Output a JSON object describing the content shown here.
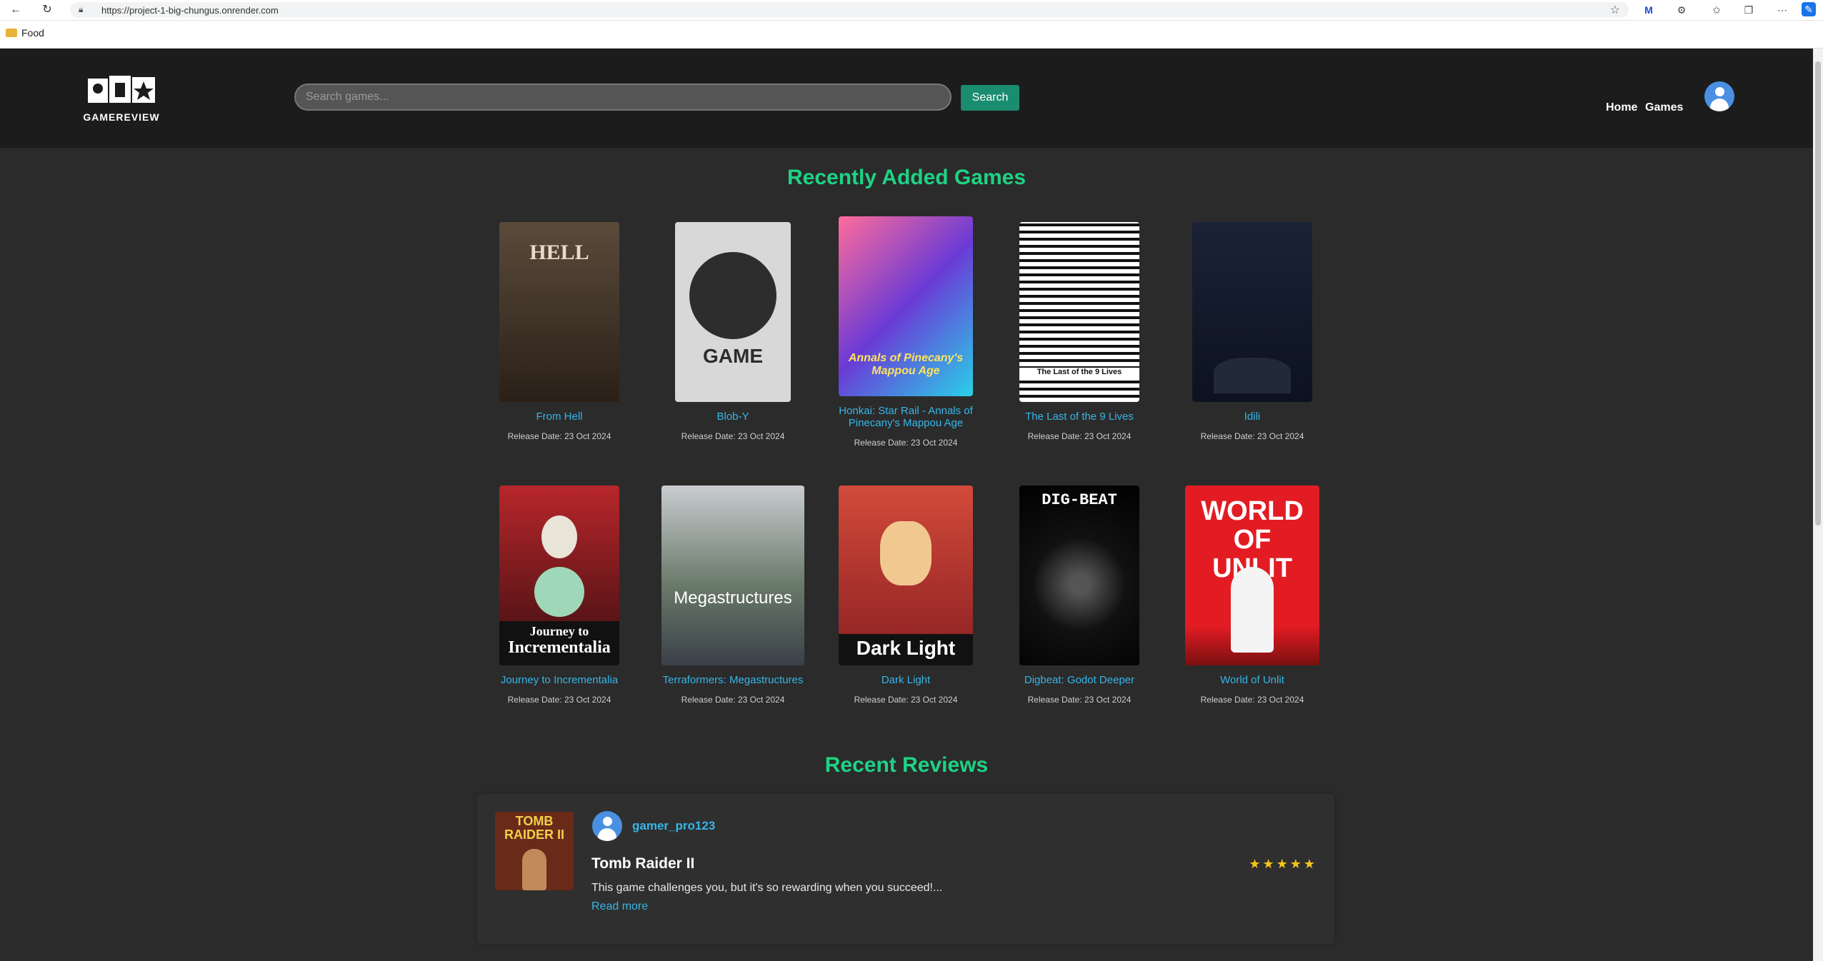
{
  "browser": {
    "url": "https://project-1-big-chungus.onrender.com",
    "bookmark_folder": "Food"
  },
  "header": {
    "logo_text": "GAMEREVIEW",
    "search_placeholder": "Search games...",
    "search_button": "Search",
    "nav": [
      {
        "label": "Home"
      },
      {
        "label": "Games"
      }
    ]
  },
  "recent_games": {
    "title": "Recently Added Games",
    "games": [
      {
        "title": "From Hell",
        "date": "Release Date: 23 Oct 2024"
      },
      {
        "title": "Blob-Y",
        "date": "Release Date: 23 Oct 2024"
      },
      {
        "title": "Honkai: Star Rail - Annals of Pinecany's Mappou Age",
        "date": "Release Date: 23 Oct 2024"
      },
      {
        "title": "The Last of the 9 Lives",
        "date": "Release Date: 23 Oct 2024"
      },
      {
        "title": "Idili",
        "date": "Release Date: 23 Oct 2024"
      },
      {
        "title": "Journey to Incrementalia",
        "date": "Release Date: 23 Oct 2024"
      },
      {
        "title": "Terraformers: Megastructures",
        "date": "Release Date: 23 Oct 2024"
      },
      {
        "title": "Dark Light",
        "date": "Release Date: 23 Oct 2024"
      },
      {
        "title": "Digbeat: Godot Deeper",
        "date": "Release Date: 23 Oct 2024"
      },
      {
        "title": "World of Unlit",
        "date": "Release Date: 23 Oct 2024"
      }
    ],
    "cover_text": {
      "from_hell": "HELL",
      "blob_y": "GAME",
      "journey_line1": "Journey to",
      "journey_line2": "Incrementalia",
      "terraformers": "Megastructures",
      "dark_light": "Dark Light",
      "digbeat": "DIG-BEAT",
      "world_unlit": "WORLD OF UNLIT",
      "honkai": "Annals of Pinecany's Mappou Age",
      "last9": "The Last of the 9 Lives"
    }
  },
  "recent_reviews": {
    "title": "Recent Reviews",
    "review": {
      "username": "gamer_pro123",
      "game": "Tomb Raider II",
      "stars": "★★★★★",
      "rating": 5,
      "excerpt": "This game challenges you, but it's so rewarding when you succeed!...",
      "read_more": "Read more",
      "cover_text": "TOMB RAIDER II"
    }
  }
}
